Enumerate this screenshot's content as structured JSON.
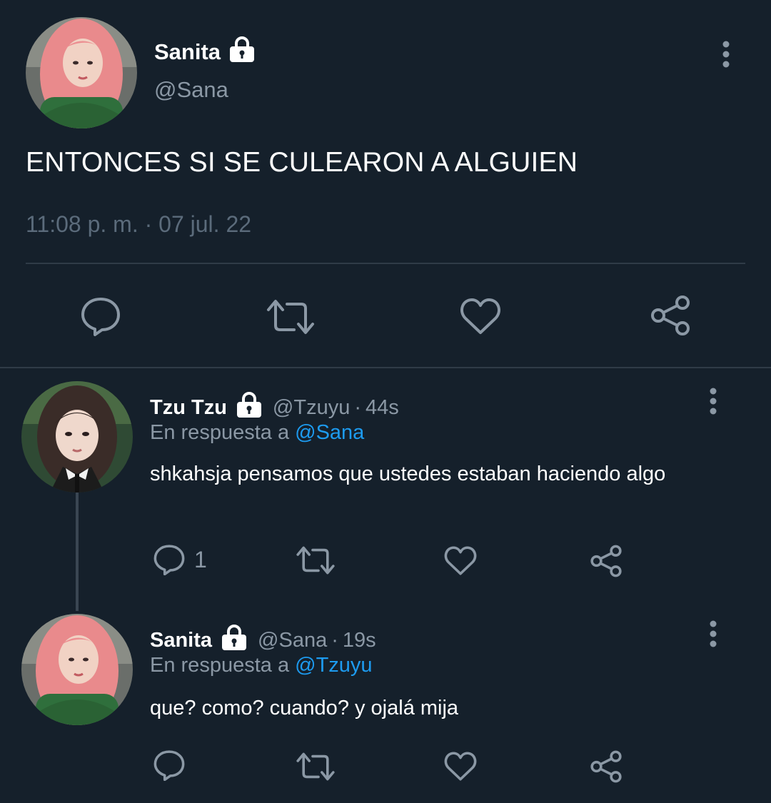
{
  "main_tweet": {
    "display_name": "Sanita",
    "handle": "@Sana",
    "text": "ENTONCES SI SE CULEARON A ALGUIEN",
    "timestamp": "11:08 p. m. · 07 jul. 22"
  },
  "replies": [
    {
      "display_name": "Tzu Tzu",
      "handle": "@Tzuyu",
      "separator": "·",
      "age": "44s",
      "in_reply_prefix": "En respuesta a",
      "in_reply_mention": "@Sana",
      "text": "shkahsja pensamos que ustedes estaban haciendo algo",
      "reply_count": "1"
    },
    {
      "display_name": "Sanita",
      "handle": "@Sana",
      "separator": "·",
      "age": "19s",
      "in_reply_prefix": "En respuesta a",
      "in_reply_mention": "@Tzuyu",
      "text": "que? como? cuando? y ojalá mija",
      "reply_count": ""
    }
  ],
  "icons": {
    "reply": "reply-icon",
    "retweet": "retweet-icon",
    "like": "like-icon",
    "share": "share-icon",
    "more": "more-icon",
    "lock": "lock-icon"
  },
  "colors": {
    "background": "#15202b",
    "text": "#ffffff",
    "secondary": "#8b98a5",
    "accent": "#1d9bf0",
    "divider": "#2f3b47"
  }
}
